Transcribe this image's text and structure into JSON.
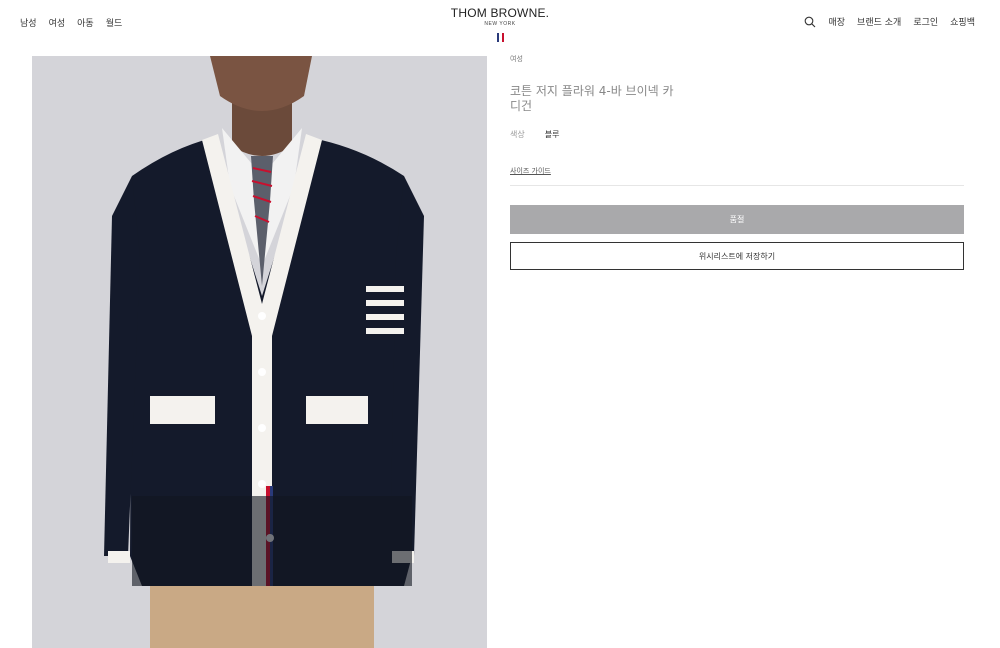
{
  "nav": {
    "left": [
      "남성",
      "여성",
      "아동",
      "월드"
    ],
    "right": [
      "매장",
      "브랜드 소개",
      "로그인",
      "쇼핑백"
    ]
  },
  "logo": {
    "main": "THOM BROWNE.",
    "sub": "NEW YORK",
    "flag_colors": [
      "#2a3a7a",
      "#c8102e"
    ]
  },
  "product": {
    "category": "여성",
    "title": "코튼 저지 플라워 4-바 브이넥 카디건",
    "color_label": "색상",
    "color_value": "블루",
    "size_guide": "사이즈 가이드",
    "sold_out": "품절",
    "wishlist": "위시리스트에 저장하기"
  },
  "colors": {
    "sold_out_bg": "#a9a9ab",
    "cardigan": "#141a2b"
  }
}
